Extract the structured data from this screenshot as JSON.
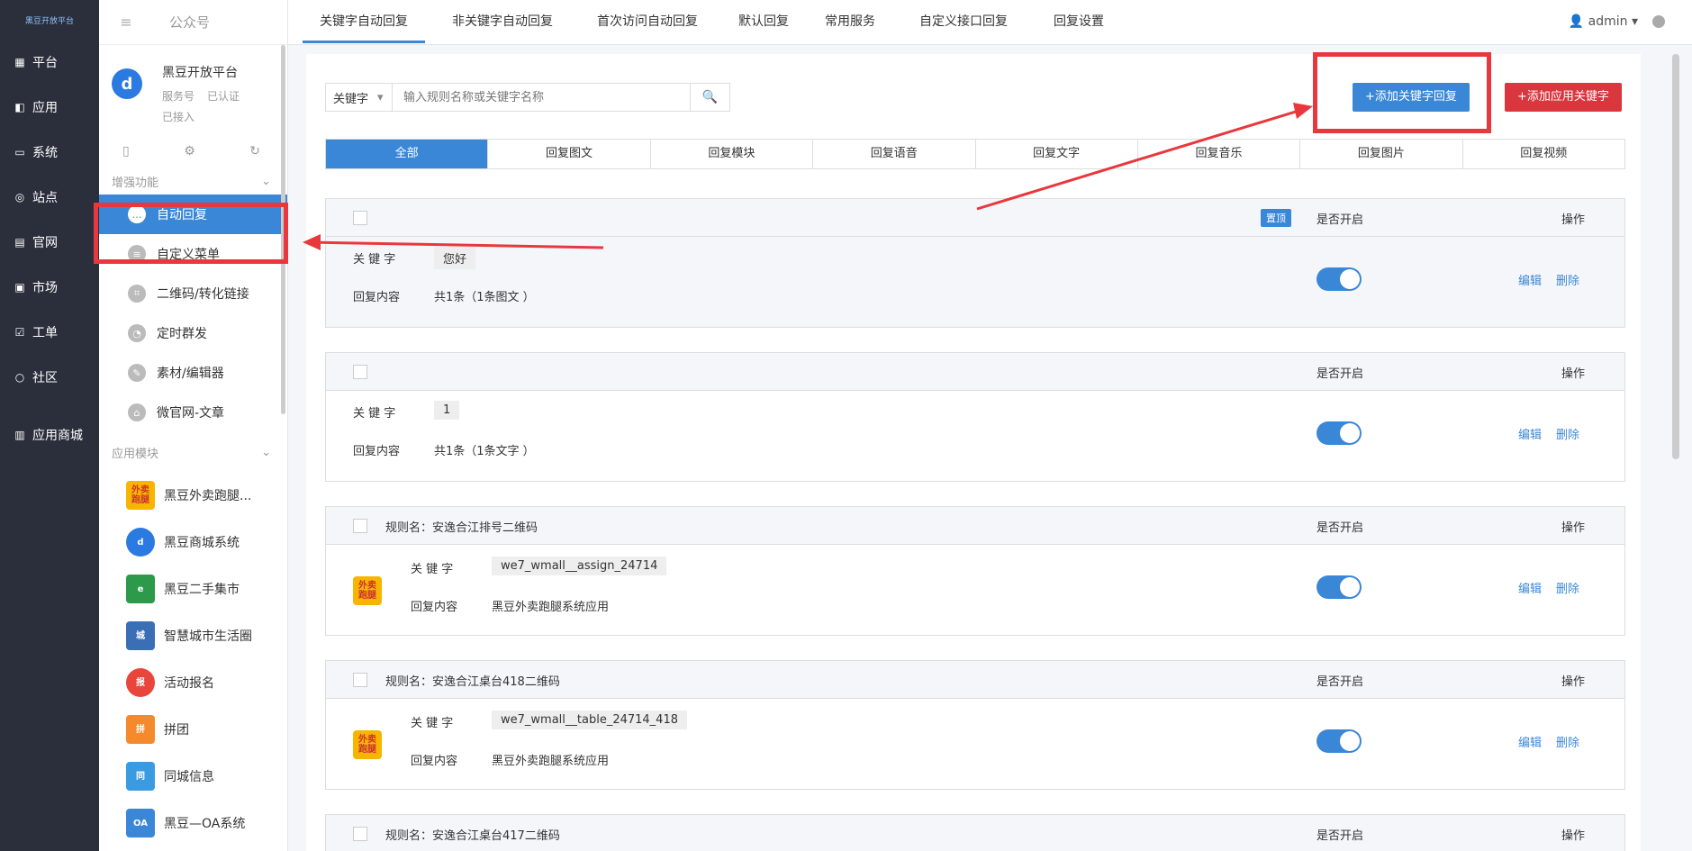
{
  "logo": {
    "text": "黑豆开放平台"
  },
  "leftnav": [
    {
      "label": "平台",
      "icon": "grid-icon"
    },
    {
      "label": "应用",
      "icon": "box-icon"
    },
    {
      "label": "系统",
      "icon": "monitor-icon"
    },
    {
      "label": "站点",
      "icon": "globe-icon"
    },
    {
      "label": "官网",
      "icon": "document-icon"
    },
    {
      "label": "市场",
      "icon": "store-icon"
    },
    {
      "label": "工单",
      "icon": "check-icon"
    },
    {
      "label": "社区",
      "icon": "comment-icon"
    },
    {
      "label": "应用商城",
      "icon": "shop-icon"
    }
  ],
  "sub": {
    "title": "公众号",
    "account": {
      "name": "黑豆开放平台",
      "type": "服务号",
      "verified": "已认证",
      "status": "已接入"
    },
    "section1": "增强功能",
    "items": [
      {
        "label": "自动回复",
        "icon": "chat-icon"
      },
      {
        "label": "自定义菜单",
        "icon": "menu-doc-icon"
      },
      {
        "label": "二维码/转化链接",
        "icon": "qrcode-icon"
      },
      {
        "label": "定时群发",
        "icon": "clock-icon"
      },
      {
        "label": "素材/编辑器",
        "icon": "edit-icon"
      },
      {
        "label": "微官网-文章",
        "icon": "home-icon"
      }
    ],
    "section2": "应用模块",
    "apps": [
      {
        "label": "黑豆外卖跑腿...",
        "icon_text": "外卖\n跑腿",
        "color": "#f7b500"
      },
      {
        "label": "黑豆商城系统",
        "icon_text": "d",
        "color": "#2a7ae2"
      },
      {
        "label": "黑豆二手集市",
        "icon_text": "e",
        "color": "#2c9a4a"
      },
      {
        "label": "智慧城市生活圈",
        "icon_text": "城",
        "color": "#3a6fb5"
      },
      {
        "label": "活动报名",
        "icon_text": "报",
        "color": "#e8453c"
      },
      {
        "label": "拼团",
        "icon_text": "拼",
        "color": "#f58a2c"
      },
      {
        "label": "同城信息",
        "icon_text": "同",
        "color": "#3b9be0"
      },
      {
        "label": "黑豆—OA系统",
        "icon_text": "OA",
        "color": "#3b87d7"
      }
    ]
  },
  "topbar": {
    "tabs": [
      "关键字自动回复",
      "非关键字自动回复",
      "首次访问自动回复",
      "默认回复",
      "常用服务",
      "自定义接口回复",
      "回复设置"
    ],
    "user": "admin"
  },
  "search": {
    "select": "关键字",
    "placeholder": "输入规则名称或关键字名称"
  },
  "buttons": {
    "add_keyword": "+添加关键字回复",
    "add_app_keyword": "+添加应用关键字"
  },
  "filter_tabs": [
    "全部",
    "回复图文",
    "回复模块",
    "回复语音",
    "回复文字",
    "回复音乐",
    "回复图片",
    "回复视频"
  ],
  "labels": {
    "enabled": "是否开启",
    "action": "操作",
    "keyword": "关 键 字",
    "content": "回复内容",
    "edit": "编辑",
    "delete": "删除",
    "top": "置顶"
  },
  "rules": [
    {
      "name": "",
      "keyword": "您好",
      "content": "共1条（1条图文 ）",
      "pinned": true
    },
    {
      "name": "",
      "keyword": "1",
      "content": "共1条（1条文字 ）",
      "pinned": false
    },
    {
      "name": "规则名：安逸合江排号二维码",
      "keyword": "we7_wmall__assign_24714",
      "content": "黑豆外卖跑腿系统应用",
      "pinned": false
    },
    {
      "name": "规则名：安逸合江桌台418二维码",
      "keyword": "we7_wmall__table_24714_418",
      "content": "黑豆外卖跑腿系统应用",
      "pinned": false
    },
    {
      "name": "规则名：安逸合江桌台417二维码",
      "keyword": "",
      "content": "",
      "pinned": false
    }
  ]
}
